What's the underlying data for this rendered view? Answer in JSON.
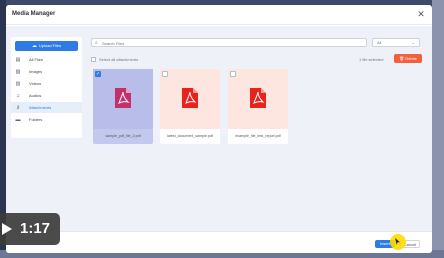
{
  "modal": {
    "title": "Media Manager",
    "close_icon": "close-icon"
  },
  "sidebar": {
    "upload_label": "Upload Files",
    "items": [
      {
        "label": "All Files",
        "icon": "file-icon",
        "active": false
      },
      {
        "label": "Images",
        "icon": "image-icon",
        "active": false
      },
      {
        "label": "Videos",
        "icon": "video-icon",
        "active": false
      },
      {
        "label": "Audios",
        "icon": "music-icon",
        "active": false
      },
      {
        "label": "Attachments",
        "icon": "paperclip-icon",
        "active": true
      },
      {
        "label": "Folders",
        "icon": "folder-icon",
        "active": false
      }
    ]
  },
  "search": {
    "placeholder": "Search Files",
    "value": ""
  },
  "filter": {
    "selected": "All"
  },
  "toolbar": {
    "select_all_label": "Select all attachments",
    "selected_count": "1 file selected",
    "delete_label": "Delete"
  },
  "files": [
    {
      "name": "sample_pdf_file_2.pdf",
      "selected": true
    },
    {
      "name": "latest_document_sample.pdf",
      "selected": false
    },
    {
      "name": "example_file_test_report.pdf",
      "selected": false
    }
  ],
  "footer": {
    "insert_label": "Insert",
    "cancel_label": "Cancel"
  },
  "video": {
    "timestamp": "1:17"
  },
  "colors": {
    "accent": "#2f7be6",
    "danger": "#f4603c",
    "pdf_red": "#e8231e"
  }
}
